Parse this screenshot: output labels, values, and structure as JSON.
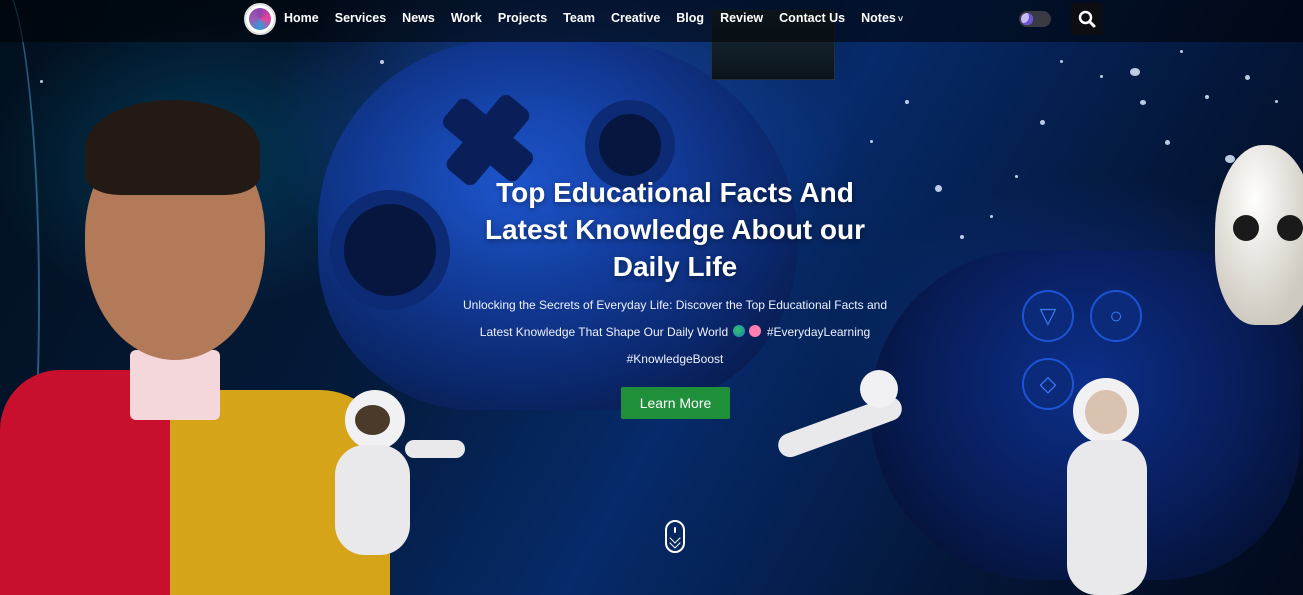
{
  "nav": {
    "logo_icon": "site-logo",
    "links": [
      {
        "label": "Home"
      },
      {
        "label": "Services"
      },
      {
        "label": "News"
      },
      {
        "label": "Work"
      },
      {
        "label": "Projects"
      },
      {
        "label": "Team"
      },
      {
        "label": "Creative"
      },
      {
        "label": "Blog"
      },
      {
        "label": "Review"
      },
      {
        "label": "Contact Us"
      },
      {
        "label": "Notes",
        "has_dropdown": true
      }
    ],
    "theme_toggle_icon": "moon-icon",
    "search_icon": "search-icon"
  },
  "hero": {
    "title_line1": "Top Educational Facts And",
    "title_line2": "Latest Knowledge About our",
    "title_line3": "Daily Life",
    "description_line1": "Unlocking the Secrets of Everyday Life: Discover the Top Educational Facts and",
    "description_line2_a": "Latest Knowledge That Shape Our Daily World",
    "description_line2_b": "#EverydayLearning",
    "description_line3": "#KnowledgeBoost",
    "emoji_1": "globe-emoji",
    "emoji_2": "brain-emoji",
    "cta_label": "Learn More",
    "scroll_icon": "mouse-scroll-icon"
  },
  "colors": {
    "cta_bg": "#1f8f3a",
    "nav_bg": "rgba(0,0,0,0.55)",
    "background": "#041a3a"
  }
}
